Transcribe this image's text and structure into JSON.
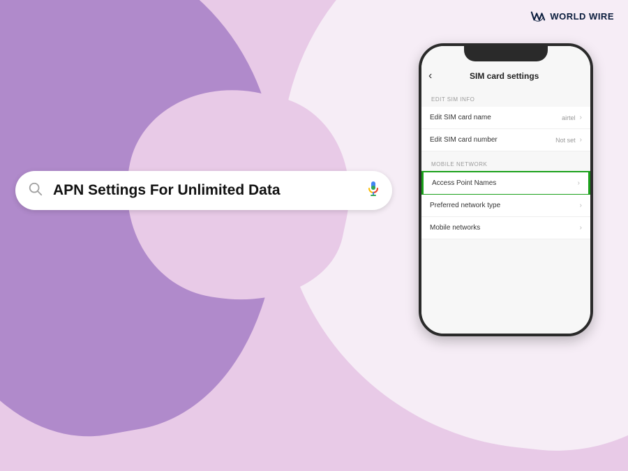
{
  "logo": {
    "text": "WORLD WIRE"
  },
  "search": {
    "text": "APN Settings For Unlimited Data"
  },
  "phone": {
    "header": {
      "back_symbol": "‹",
      "title": "SIM card settings"
    },
    "sections": {
      "edit_sim_info": {
        "label": "EDIT SIM INFO",
        "rows": [
          {
            "title": "Edit SIM card name",
            "value": "airtel"
          },
          {
            "title": "Edit SIM card number",
            "value": "Not set"
          }
        ]
      },
      "mobile_network": {
        "label": "MOBILE NETWORK",
        "rows": [
          {
            "title": "Access Point Names",
            "value": ""
          },
          {
            "title": "Preferred network type",
            "value": ""
          },
          {
            "title": "Mobile networks",
            "value": ""
          }
        ]
      }
    }
  }
}
